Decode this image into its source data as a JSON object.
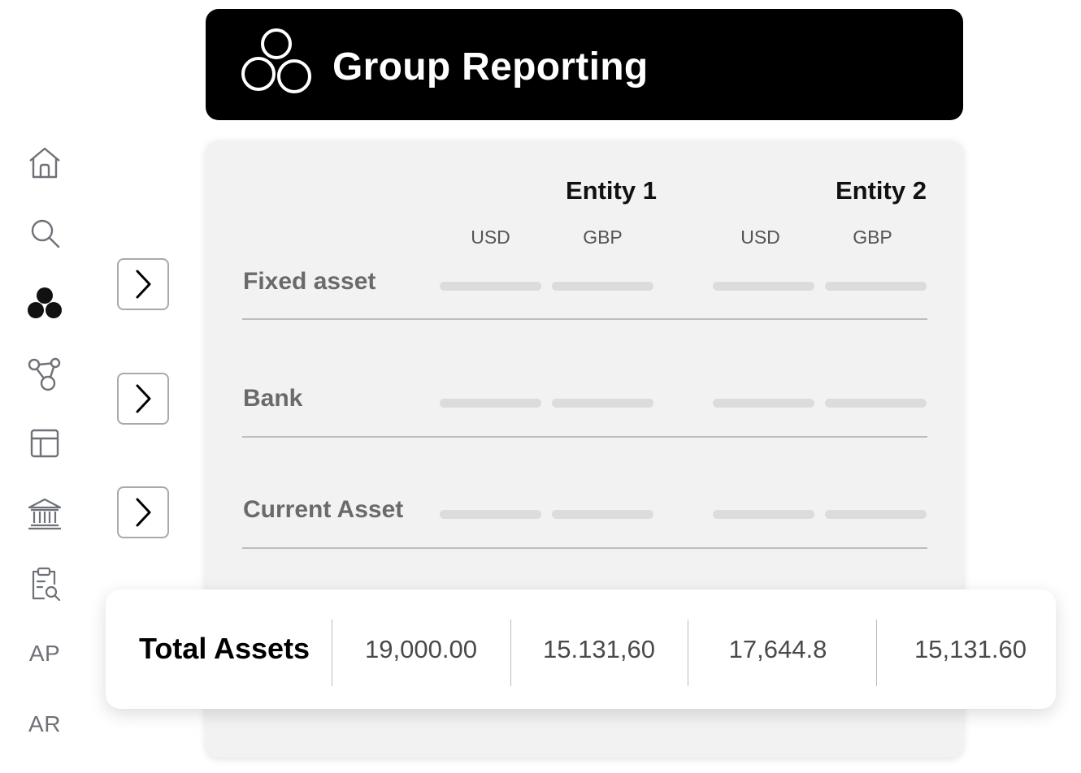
{
  "header": {
    "title": "Group Reporting",
    "logo_icon": "three-circles-icon"
  },
  "sidebar": {
    "items": [
      {
        "icon": "home-icon"
      },
      {
        "icon": "search-icon"
      },
      {
        "icon": "group-circles-icon",
        "active": true
      },
      {
        "icon": "network-icon"
      },
      {
        "icon": "table-icon"
      },
      {
        "icon": "bank-icon"
      },
      {
        "icon": "clipboard-search-icon"
      },
      {
        "label": "AP"
      },
      {
        "label": "AR"
      }
    ]
  },
  "table": {
    "entities": [
      "Entity 1",
      "Entity 2"
    ],
    "currencies": [
      "USD",
      "GBP",
      "USD",
      "GBP"
    ],
    "rows": [
      {
        "label": "Fixed asset"
      },
      {
        "label": "Bank"
      },
      {
        "label": "Current Asset"
      }
    ]
  },
  "totals": {
    "label": "Total Assets",
    "values": [
      "19,000.00",
      "15.131,60",
      "17,644.8",
      "15,131.60"
    ]
  },
  "colors": {
    "header_bg": "#000000",
    "card_bg": "#f2f2f2",
    "icon_gray": "#6e7177",
    "active_icon": "#111111"
  }
}
